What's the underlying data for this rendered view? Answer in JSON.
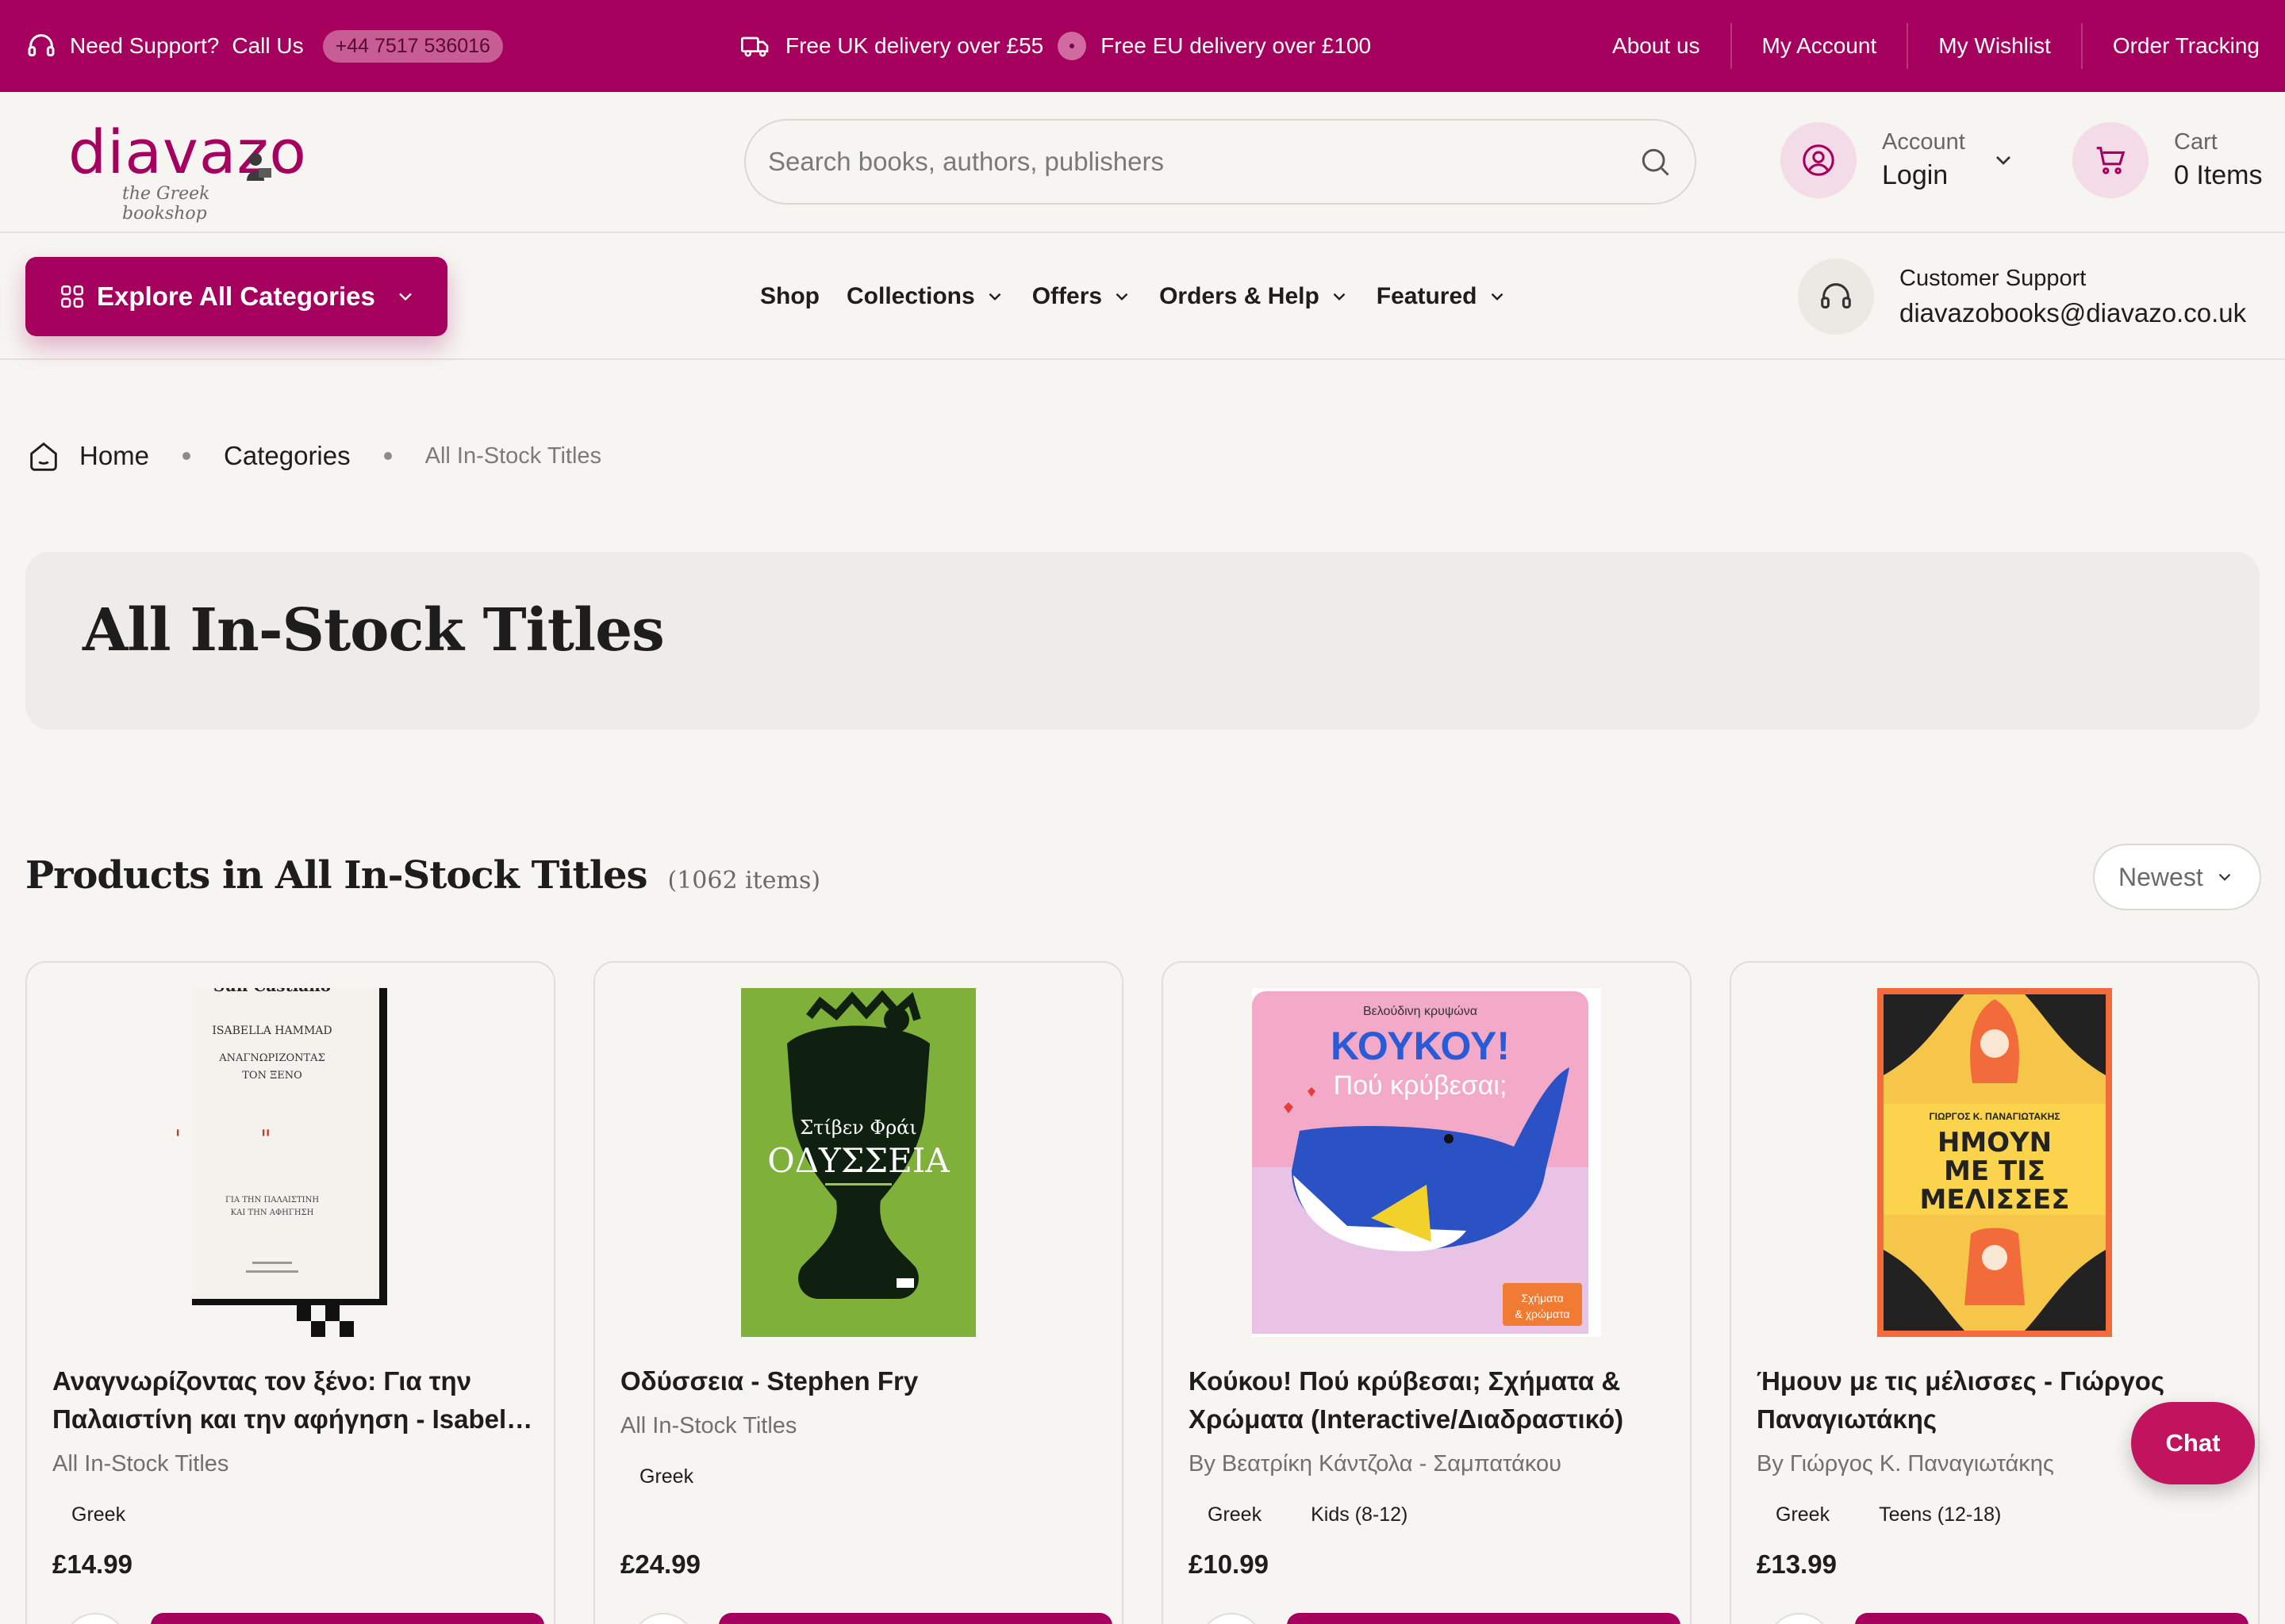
{
  "topbar": {
    "support_label": "Need Support?",
    "call_label": "Call Us",
    "phone": "+44 7517 536016",
    "uk_delivery": "Free UK delivery over £55",
    "eu_delivery": "Free EU delivery over £100",
    "links": [
      "About us",
      "My Account",
      "My Wishlist",
      "Order Tracking"
    ]
  },
  "header": {
    "logo_word": "diavazo",
    "logo_tagline": "the Greek bookshop",
    "search_placeholder": "Search books, authors, publishers",
    "account_small": "Account",
    "account_big": "Login",
    "cart_small": "Cart",
    "cart_big": "0 Items"
  },
  "nav": {
    "explore_label": "Explore All Categories",
    "items": [
      "Shop",
      "Collections",
      "Offers",
      "Orders & Help",
      "Featured"
    ],
    "support_small": "Customer Support",
    "support_email": "diavazobooks@diavazo.co.uk"
  },
  "breadcrumb": {
    "home": "Home",
    "categories": "Categories",
    "current": "All In-Stock Titles"
  },
  "hero": {
    "title": "All In-Stock Titles"
  },
  "products_head": {
    "title": "Products in All In-Stock Titles",
    "count": "(1062 items)",
    "sort": "Newest"
  },
  "products": [
    {
      "title": "Αναγνωρίζοντας τον ξένο: Για την Παλαιστίνη και την αφήγηση - Isabella Hammad",
      "byline": "All In-Stock Titles",
      "tags": [
        "Greek"
      ],
      "price": "£14.99",
      "cover": {
        "bg": "#f4f2ec",
        "header": "Sun Castiano",
        "author": "ISABELLA HAMMAD",
        "title1": "ΑΝΑΓΝΩΡΙΖΟΝΤΑΣ",
        "title2": "ΤΟΝ ΞΕΝΟ",
        "sub1": "ΓΙΑ ΤΗΝ ΠΑΛΑΙΣΤΙΝΗ",
        "sub2": "ΚΑΙ ΤΗΝ ΑΦΗΓΗΣΗ"
      }
    },
    {
      "title": "Οδύσσεια - Stephen Fry",
      "byline": "All In-Stock Titles",
      "tags": [
        "Greek"
      ],
      "price": "£24.99",
      "cover": {
        "bg": "#7fb13a",
        "author": "Στίβεν Φράι",
        "title": "ΟΔΥΣΣΕΙΑ"
      }
    },
    {
      "title": "Κούκου! Πού κρύβεσαι; Σχήματα & Χρώματα (Interactive/Διαδραστικό)",
      "byline": "By Βεατρίκη Κάντζολα - Σαμπατάκου",
      "tags": [
        "Greek",
        "Kids (8-12)"
      ],
      "price": "£10.99",
      "cover": {
        "bg": "#f3a9c8",
        "top": "Βελούδινη κρυψώνα",
        "title": "ΚΟΥΚΟΥ!",
        "sub": "Πού κρύβεσαι;",
        "badge1": "Σχήματα",
        "badge2": "& χρώματα"
      }
    },
    {
      "title": "Ήμουν με τις μέλισσες - Γιώργος Παναγιωτάκης",
      "byline": "By Γιώργος Κ. Παναγιωτάκης",
      "tags": [
        "Greek",
        "Teens (12-18)"
      ],
      "price": "£13.99",
      "cover": {
        "bg": "#f26b3a",
        "author": "ΓΙΩΡΓΟΣ Κ. ΠΑΝΑΓΙΩΤΑΚΗΣ",
        "t1": "ΗΜΟΥΝ",
        "t2": "ΜΕ ΤΙΣ",
        "t3": "ΜΕΛΙΣΣΕΣ"
      }
    }
  ],
  "chat_label": "Chat",
  "colors": {
    "brand": "#a5005e",
    "accent_soft": "#f3dce8",
    "chat": "#c2145e",
    "page_bg": "#f7f5f2"
  }
}
